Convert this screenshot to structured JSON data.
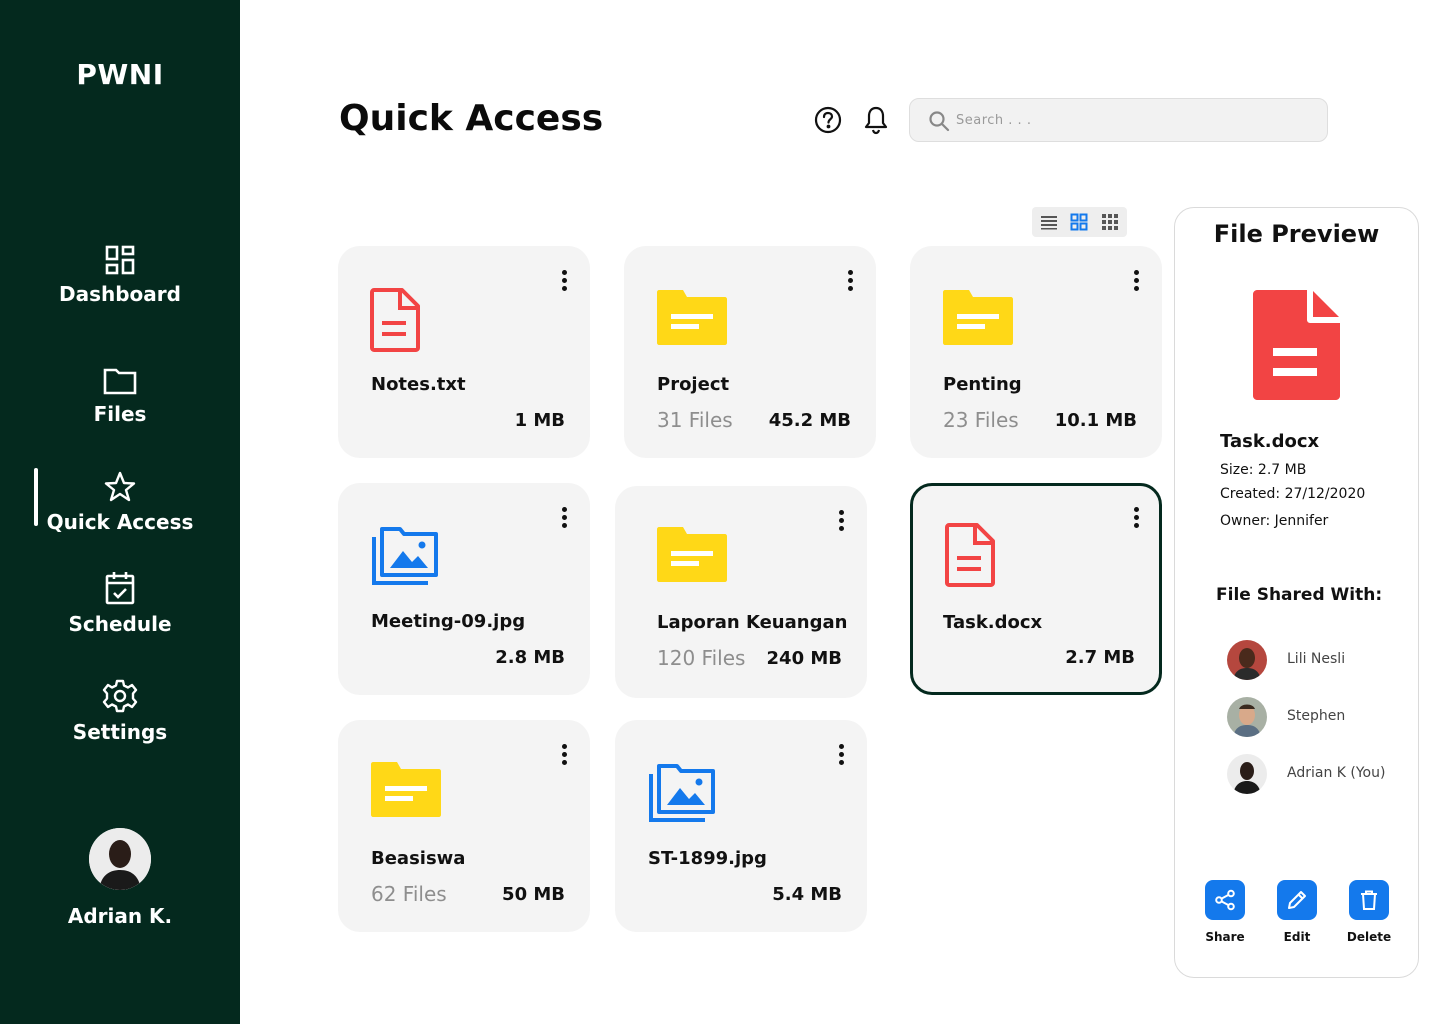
{
  "app": {
    "brand": "PWNI"
  },
  "sidebar": {
    "items": [
      {
        "label": "Dashboard",
        "icon": "dashboard-icon"
      },
      {
        "label": "Files",
        "icon": "folder-icon"
      },
      {
        "label": "Quick Access",
        "icon": "star-icon",
        "active": true
      },
      {
        "label": "Schedule",
        "icon": "calendar-check-icon"
      },
      {
        "label": "Settings",
        "icon": "gear-icon"
      }
    ],
    "user": {
      "name": "Adrian K."
    }
  },
  "header": {
    "title": "Quick Access",
    "search_placeholder": "Search . . ."
  },
  "colors": {
    "sidebar_bg": "#04291e",
    "doc_red": "#f24444",
    "folder_yellow": "#ffd817",
    "image_blue": "#1479ec",
    "card_bg": "#f4f4f4"
  },
  "cards": [
    {
      "name": "Notes.txt",
      "type": "document",
      "count": "",
      "size": "1 MB"
    },
    {
      "name": "Project",
      "type": "folder",
      "count": "31 Files",
      "size": "45.2 MB"
    },
    {
      "name": "Penting",
      "type": "folder",
      "count": "23 Files",
      "size": "10.1 MB"
    },
    {
      "name": "Meeting-09.jpg",
      "type": "image",
      "count": "",
      "size": "2.8 MB"
    },
    {
      "name": "Laporan Keuangan",
      "type": "folder",
      "count": "120 Files",
      "size": "240 MB"
    },
    {
      "name": "Task.docx",
      "type": "document",
      "count": "",
      "size": "2.7 MB",
      "selected": true
    },
    {
      "name": "Beasiswa",
      "type": "folder",
      "count": "62 Files",
      "size": "50 MB"
    },
    {
      "name": "ST-1899.jpg",
      "type": "image",
      "count": "",
      "size": "5.4 MB"
    }
  ],
  "preview": {
    "title": "File Preview",
    "file_name": "Task.docx",
    "size": "Size: 2.7 MB",
    "created": "Created: 27/12/2020",
    "owner": "Owner: Jennifer",
    "shared_title": "File Shared With:",
    "shared_with": [
      {
        "name": "Lili Nesli"
      },
      {
        "name": "Stephen"
      },
      {
        "name": "Adrian K (You)"
      }
    ],
    "actions": [
      {
        "label": "Share",
        "icon": "share-icon"
      },
      {
        "label": "Edit",
        "icon": "pencil-icon"
      },
      {
        "label": "Delete",
        "icon": "trash-icon"
      }
    ]
  }
}
